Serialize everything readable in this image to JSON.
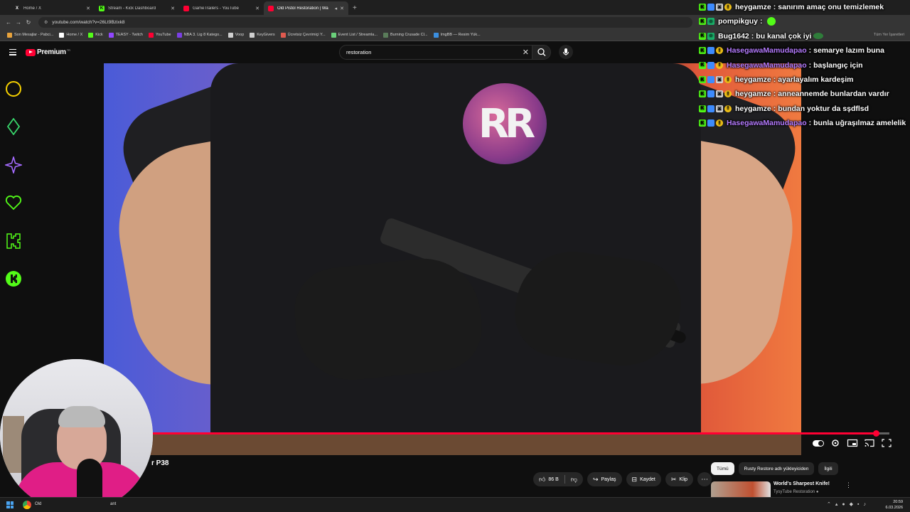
{
  "browser": {
    "tabs": [
      {
        "label": "Home / X",
        "icon": "x-icon",
        "active": false
      },
      {
        "label": "Stream - Kick Dashboard",
        "icon": "kick-icon",
        "active": false
      },
      {
        "label": "GameTrailers - YouTube",
        "icon": "youtube-icon",
        "active": false
      },
      {
        "label": "Old Pistol Restoration | Wa",
        "icon": "youtube-icon",
        "active": true
      }
    ],
    "url": "youtube.com/watch?v=26Lt9Bzixk8",
    "bookmarks": [
      {
        "label": "Son Mesajlar - Pabci...",
        "color": "#e8a33c"
      },
      {
        "label": "Home / X",
        "color": "#ffffff"
      },
      {
        "label": "Kick",
        "color": "#53fc18"
      },
      {
        "label": "TEASY - Twitch",
        "color": "#9146ff"
      },
      {
        "label": "YouTube",
        "color": "#ff0033"
      },
      {
        "label": "NBA 3. Lig 8 Katego...",
        "color": "#7b3fe4"
      },
      {
        "label": "Voop",
        "color": "#cfcfcf"
      },
      {
        "label": "KeyGivers",
        "color": "#cfcfcf"
      },
      {
        "label": "Ücretsiz Çevrimiçi Y...",
        "color": "#e05a4f"
      },
      {
        "label": "Event List / Streamla...",
        "color": "#6ad07a"
      },
      {
        "label": "Burning Crusade Cl...",
        "color": "#5a7c5a"
      },
      {
        "label": "ImgBB — Resim Yük...",
        "color": "#3b8fe0"
      }
    ],
    "bookmarks_right": "Tüm Yer İşaretleri"
  },
  "youtube": {
    "brand": "Premium",
    "region": "TR",
    "search_value": "restoration",
    "video_title_visible": "r P38",
    "progress_fraction": 0.982,
    "actions": {
      "likes": "86 B",
      "share": "Paylaş",
      "save": "Kaydet",
      "clip": "Klip"
    },
    "chips": [
      "Tümü",
      "Rusty Restore adlı yükleyiciden",
      "İlgili"
    ],
    "recommendation": {
      "title": "World's Sharpest Knife!",
      "channel": "TysyTube Restoration"
    }
  },
  "chat": [
    {
      "user": "heygamze",
      "color": "#ffffff",
      "message": "sanırım amaç onu temizlemek",
      "badges": [
        "kick",
        "blue",
        "sword",
        "coin"
      ]
    },
    {
      "user": "pompikguy",
      "color": "#ffffff",
      "message": "",
      "badges": [
        "kick",
        "mod"
      ],
      "emoji": true
    },
    {
      "user": "Bug1642",
      "color": "#ffffff",
      "message": "bu kanal çok iyi",
      "badges": [
        "kick",
        "mod"
      ],
      "emoji2": true
    },
    {
      "user": "HasegawaMamudapao",
      "color": "#b57bff",
      "message": "semarye lazım buna",
      "badges": [
        "kick",
        "blue",
        "coin"
      ]
    },
    {
      "user": "HasegawaMamudapao",
      "color": "#b57bff",
      "message": "başlangıç için",
      "badges": [
        "kick",
        "blue",
        "coin"
      ]
    },
    {
      "user": "heygamze",
      "color": "#ffffff",
      "message": "ayarlayalım kardeşim",
      "badges": [
        "kick",
        "blue",
        "sword",
        "coin"
      ]
    },
    {
      "user": "heygamze",
      "color": "#ffffff",
      "message": "anneannemde bunlardan vardır",
      "badges": [
        "kick",
        "blue",
        "sword",
        "coin"
      ]
    },
    {
      "user": "heygamze",
      "color": "#ffffff",
      "message": "bundan yoktur da sşdflsd",
      "badges": [
        "kick",
        "blue",
        "sword",
        "coin"
      ]
    },
    {
      "user": "HasegawaMamudapao",
      "color": "#b57bff",
      "message": "bunla uğraşılmaz amelelik",
      "badges": [
        "kick",
        "blue",
        "coin"
      ]
    }
  ],
  "video_logo": "RR",
  "taskbar": {
    "app_label": "Old",
    "app_label2": "ant",
    "time": "20:59",
    "date": "6.03.2026"
  },
  "colors": {
    "accent": "#ff0033",
    "kick": "#53fc18"
  }
}
